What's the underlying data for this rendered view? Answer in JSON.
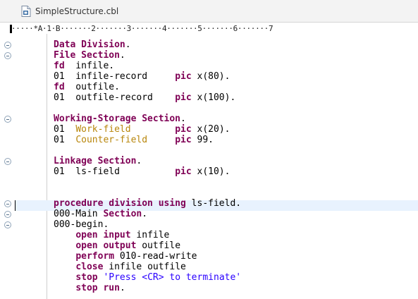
{
  "tab": {
    "title": "SimpleStructure.cbl",
    "icon": "cobol-file-icon"
  },
  "ruler": "·····*A·1·B·······2·······3·······4·······5·······6·······7",
  "colors": {
    "keyword": "#7f0055",
    "string": "#2a00ff",
    "data_name": "#b8860b",
    "current_line": "#e8f2fe"
  },
  "lines": [
    {
      "row": 0,
      "fold": true,
      "tokens": [
        {
          "t": "Data Division",
          "c": "kw"
        },
        {
          "t": "."
        }
      ]
    },
    {
      "row": 1,
      "fold": true,
      "tokens": [
        {
          "t": "File Section",
          "c": "kw"
        },
        {
          "t": "."
        }
      ]
    },
    {
      "row": 2,
      "tokens": [
        {
          "t": "fd",
          "c": "kw"
        },
        {
          "t": "  infile."
        }
      ]
    },
    {
      "row": 3,
      "tokens": [
        {
          "t": "01  infile-record     "
        },
        {
          "t": "pic",
          "c": "kw"
        },
        {
          "t": " x(80)."
        }
      ]
    },
    {
      "row": 4,
      "tokens": [
        {
          "t": "fd",
          "c": "kw"
        },
        {
          "t": "  outfile."
        }
      ]
    },
    {
      "row": 5,
      "tokens": [
        {
          "t": "01  outfile-record    "
        },
        {
          "t": "pic",
          "c": "kw"
        },
        {
          "t": " x(100)."
        }
      ]
    },
    {
      "row": 7,
      "fold": true,
      "tokens": [
        {
          "t": "Working-Storage Section",
          "c": "kw"
        },
        {
          "t": "."
        }
      ]
    },
    {
      "row": 8,
      "tokens": [
        {
          "t": "01  "
        },
        {
          "t": "Work-field",
          "c": "dt"
        },
        {
          "t": "        "
        },
        {
          "t": "pic",
          "c": "kw"
        },
        {
          "t": " x(20)."
        }
      ]
    },
    {
      "row": 9,
      "tokens": [
        {
          "t": "01  "
        },
        {
          "t": "Counter-field",
          "c": "dt"
        },
        {
          "t": "     "
        },
        {
          "t": "pic",
          "c": "kw"
        },
        {
          "t": " 99."
        }
      ]
    },
    {
      "row": 11,
      "fold": true,
      "tokens": [
        {
          "t": "Linkage Section",
          "c": "kw"
        },
        {
          "t": "."
        }
      ]
    },
    {
      "row": 12,
      "tokens": [
        {
          "t": "01  ls-field          "
        },
        {
          "t": "pic",
          "c": "kw"
        },
        {
          "t": " x(10)."
        }
      ]
    },
    {
      "row": 15,
      "fold": true,
      "tokens": [
        {
          "t": "procedure division using",
          "c": "kw"
        },
        {
          "t": " ls-field."
        }
      ]
    },
    {
      "row": 16,
      "fold": true,
      "tokens": [
        {
          "t": "000-Main "
        },
        {
          "t": "Section",
          "c": "kw"
        },
        {
          "t": "."
        }
      ]
    },
    {
      "row": 17,
      "fold": true,
      "tokens": [
        {
          "t": "000-begin."
        }
      ]
    },
    {
      "row": 18,
      "tokens": [
        {
          "t": "    "
        },
        {
          "t": "open input",
          "c": "kw"
        },
        {
          "t": " infile"
        }
      ]
    },
    {
      "row": 19,
      "tokens": [
        {
          "t": "    "
        },
        {
          "t": "open output",
          "c": "kw"
        },
        {
          "t": " outfile"
        }
      ]
    },
    {
      "row": 20,
      "tokens": [
        {
          "t": "    "
        },
        {
          "t": "perform",
          "c": "kw"
        },
        {
          "t": " 010-read-write"
        }
      ]
    },
    {
      "row": 21,
      "tokens": [
        {
          "t": "    "
        },
        {
          "t": "close",
          "c": "kw"
        },
        {
          "t": " infile outfile"
        }
      ]
    },
    {
      "row": 22,
      "tokens": [
        {
          "t": "    "
        },
        {
          "t": "stop",
          "c": "kw"
        },
        {
          "t": " "
        },
        {
          "t": "'Press <CR> to terminate'",
          "c": "str"
        }
      ]
    },
    {
      "row": 23,
      "tokens": [
        {
          "t": "    "
        },
        {
          "t": "stop run",
          "c": "kw"
        },
        {
          "t": "."
        }
      ]
    }
  ]
}
